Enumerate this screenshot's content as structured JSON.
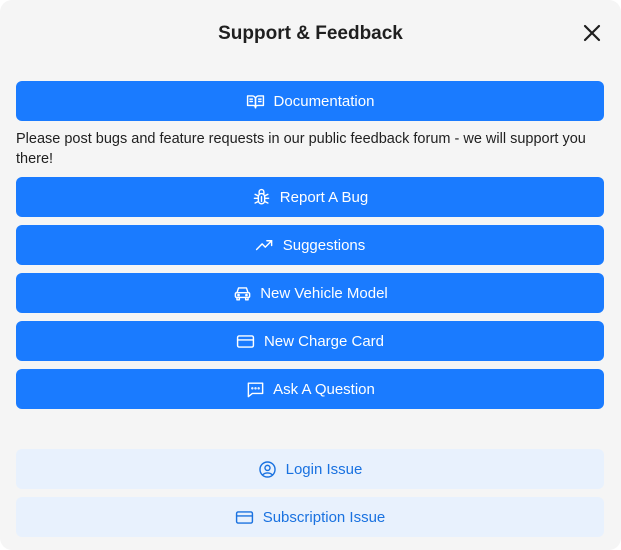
{
  "dialog": {
    "title": "Support & Feedback",
    "close_icon": "close-icon"
  },
  "documentation": {
    "label": "Documentation",
    "icon": "book-open-icon"
  },
  "info_text": "Please post bugs and feature requests in our public feedback forum - we will support you there!",
  "feedback_buttons": [
    {
      "label": "Report A Bug",
      "icon": "bug-icon"
    },
    {
      "label": "Suggestions",
      "icon": "trending-up-icon"
    },
    {
      "label": "New Vehicle Model",
      "icon": "car-icon"
    },
    {
      "label": "New Charge Card",
      "icon": "credit-card-icon"
    },
    {
      "label": "Ask A Question",
      "icon": "message-dots-icon"
    }
  ],
  "account_buttons": [
    {
      "label": "Login Issue",
      "icon": "user-circle-icon"
    },
    {
      "label": "Subscription Issue",
      "icon": "credit-card-icon"
    }
  ],
  "colors": {
    "primary": "#1a7bff",
    "secondary_bg": "#e8f1fd",
    "secondary_text": "#1a72e0",
    "modal_bg": "#f5f5f5"
  }
}
